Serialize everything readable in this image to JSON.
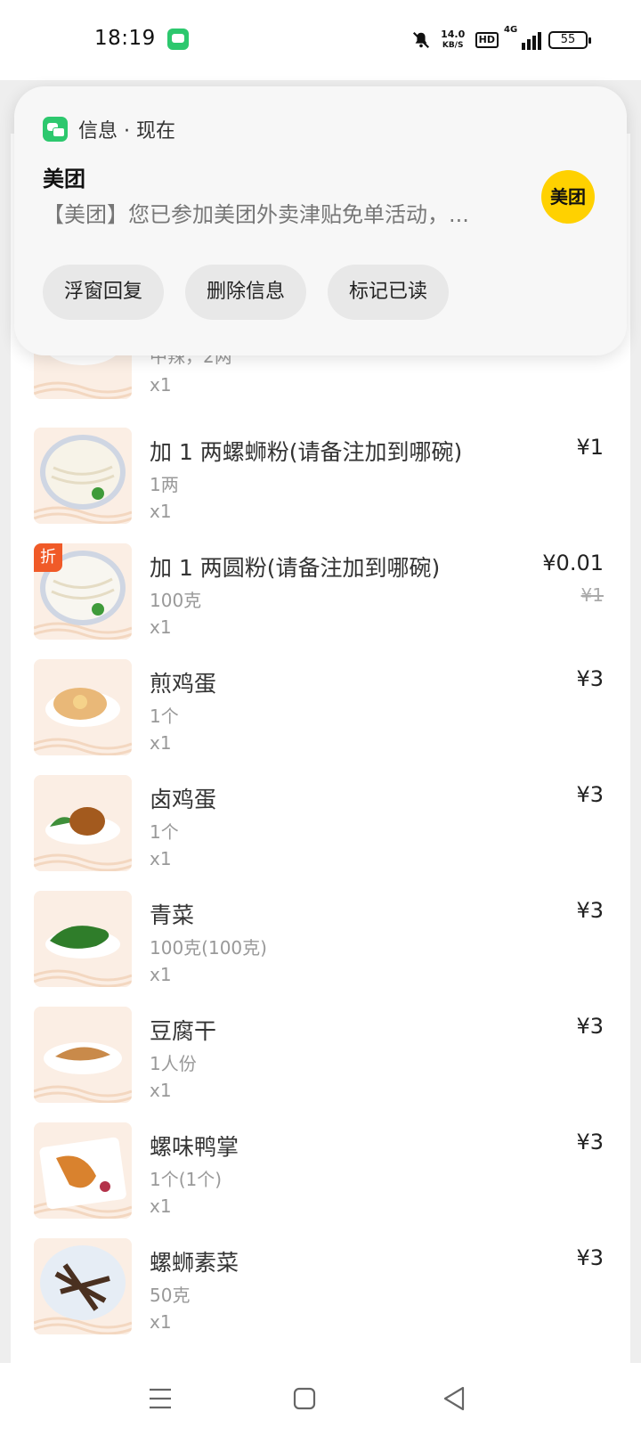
{
  "status_bar": {
    "time": "18:19",
    "net_speed_value": "14.0",
    "net_speed_unit": "KB/S",
    "hd_badge": "HD",
    "network_type": "4G",
    "battery": "55"
  },
  "notification": {
    "header": "信息 · 现在",
    "title": "美团",
    "body": "【美团】您已参加美团外卖津贴免单活动，...",
    "avatar_text": "美团",
    "actions": [
      "浮窗回复",
      "删除信息",
      "标记已读"
    ],
    "icon": "message-icon",
    "avatar_color": "#ffd100"
  },
  "order_items": [
    {
      "name": "",
      "spec": "中辣，2两",
      "qty": "x1",
      "price": "",
      "icon": "noodle-soup-image"
    },
    {
      "name": "加 1 两螺蛳粉(请备注加到哪碗)",
      "spec": "1两",
      "qty": "x1",
      "price": "¥1",
      "icon": "rice-noodle-image"
    },
    {
      "name": "加 1 两圆粉(请备注加到哪碗)",
      "spec": "100克",
      "qty": "x1",
      "price": "¥0.01",
      "original_price": "¥1",
      "badge": "折",
      "icon": "round-noodle-image"
    },
    {
      "name": "煎鸡蛋",
      "spec": "1个",
      "qty": "x1",
      "price": "¥3",
      "icon": "fried-egg-image"
    },
    {
      "name": "卤鸡蛋",
      "spec": "1个",
      "qty": "x1",
      "price": "¥3",
      "icon": "braised-egg-image"
    },
    {
      "name": "青菜",
      "spec": "100克(100克)",
      "qty": "x1",
      "price": "¥3",
      "icon": "greens-image"
    },
    {
      "name": "豆腐干",
      "spec": "1人份",
      "qty": "x1",
      "price": "¥3",
      "icon": "tofu-image"
    },
    {
      "name": "螺味鸭掌",
      "spec": "1个(1个)",
      "qty": "x1",
      "price": "¥3",
      "icon": "duck-feet-image"
    },
    {
      "name": "螺蛳素菜",
      "spec": "50克",
      "qty": "x1",
      "price": "¥3",
      "icon": "vegetable-dish-image"
    }
  ],
  "nav": {
    "menu_icon": "menu-icon",
    "home_icon": "home-icon",
    "back_icon": "back-icon"
  },
  "colors": {
    "discount": "#f05a28",
    "app_green": "#2dc86e",
    "meituan_yellow": "#ffd100"
  }
}
